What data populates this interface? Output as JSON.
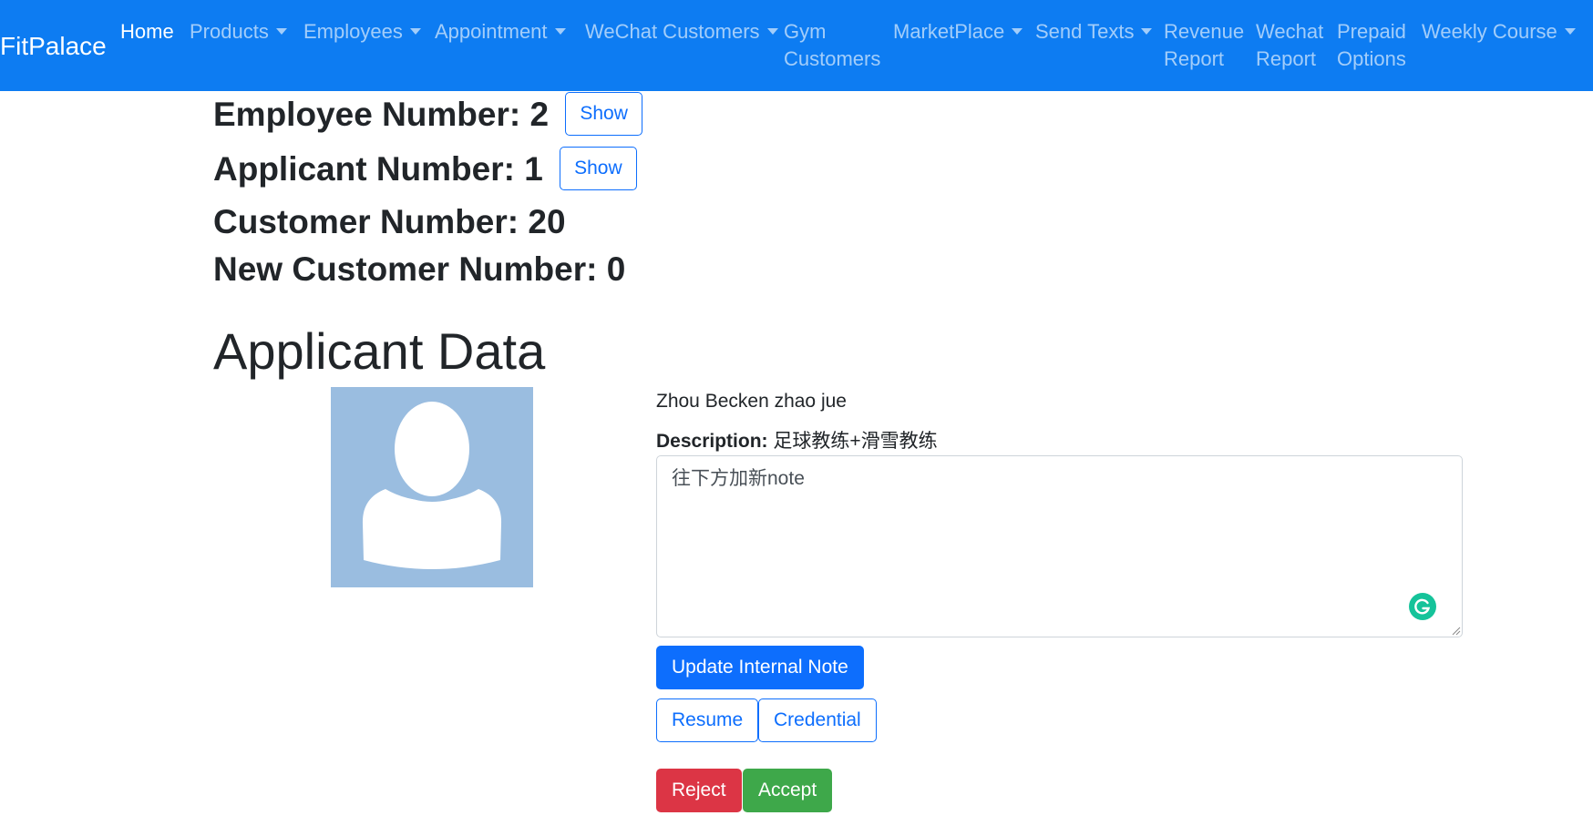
{
  "navbar": {
    "brand": "FitPalace",
    "items": [
      {
        "label": "Home"
      },
      {
        "label": "Products"
      },
      {
        "label": "Employees"
      },
      {
        "label": "Appointment"
      },
      {
        "label": "WeChat Customers"
      },
      {
        "label_line1": "Gym",
        "label_line2": "Customers"
      },
      {
        "label": "MarketPlace"
      },
      {
        "label": "Send Texts"
      },
      {
        "label_line1": "Revenue",
        "label_line2": "Report"
      },
      {
        "label_line1": "Wechat",
        "label_line2": "Report"
      },
      {
        "label_line1": "Prepaid",
        "label_line2": "Options"
      },
      {
        "label": "Weekly Course"
      }
    ]
  },
  "stats": {
    "employee_label": "Employee Number: 2",
    "employee_button": "Show",
    "applicant_label": "Applicant Number: 1",
    "applicant_button": "Show",
    "customer_label": "Customer Number: 20",
    "new_customer_label": "New Customer Number: 0"
  },
  "applicant": {
    "section_title": "Applicant Data",
    "name": "Zhou Becken zhao jue",
    "description_label": "Description:",
    "description_value": "足球教练+滑雪教练",
    "note_value": "往下方加新note",
    "update_note_button": "Update Internal Note",
    "resume_button": "Resume",
    "credential_button": "Credential",
    "reject_button": "Reject",
    "accept_button": "Accept"
  },
  "colors": {
    "navbar": "#0d7cf2",
    "primary": "#0d6efd",
    "danger": "#dc3545",
    "success": "#3ea84a",
    "avatar_bg": "#9abde0"
  }
}
